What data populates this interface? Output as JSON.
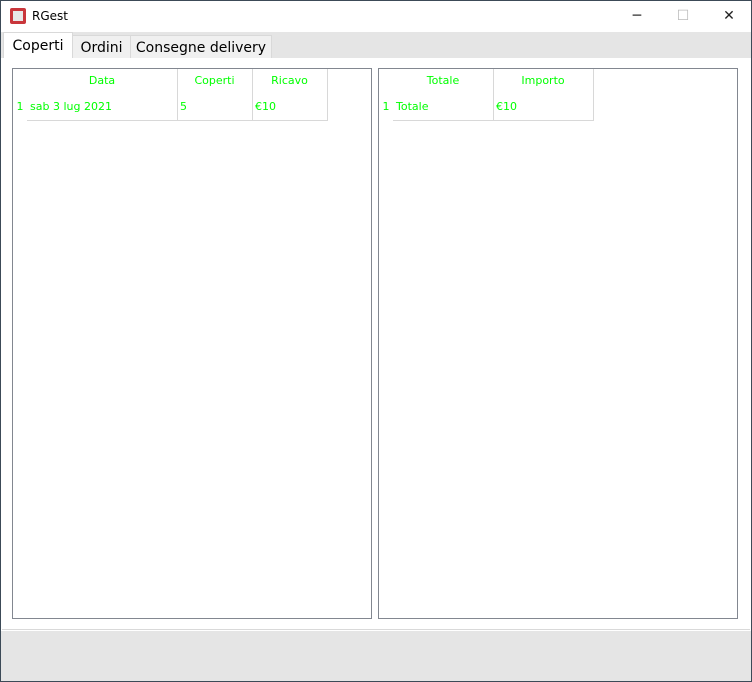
{
  "window": {
    "title": "RGest",
    "controls": {
      "minimize": "─",
      "maximize": "☐",
      "close": "✕"
    }
  },
  "tabs": [
    {
      "label": "Coperti",
      "active": true
    },
    {
      "label": "Ordini"
    },
    {
      "label": "Consegne delivery"
    }
  ],
  "left_table": {
    "columns": [
      "Data",
      "Coperti",
      "Ricavo"
    ],
    "rows": [
      {
        "index": "1",
        "cells": [
          "sab 3 lug 2021",
          "5",
          "€10"
        ]
      }
    ]
  },
  "right_table": {
    "columns": [
      "Totale",
      "Importo"
    ],
    "rows": [
      {
        "index": "1",
        "cells": [
          "Totale",
          "€10"
        ]
      }
    ]
  },
  "colors": {
    "text": "#00ff00"
  }
}
